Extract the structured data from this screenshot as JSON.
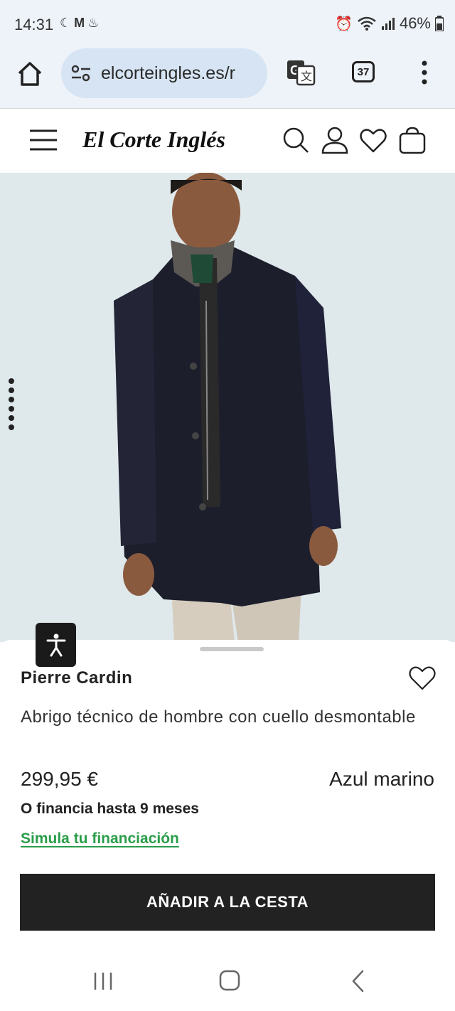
{
  "status_bar": {
    "time": "14:31",
    "left_icons": [
      "moon-icon",
      "gmail-icon",
      "notification-icon"
    ],
    "right_icons": [
      "alarm-icon",
      "wifi-icon",
      "signal-icon"
    ],
    "battery": "46%"
  },
  "browser": {
    "url": "elcorteingles.es/r",
    "tab_count": "37",
    "icons": [
      "home-icon",
      "site-settings-icon",
      "translate-icon",
      "tabs-icon",
      "more-vert-icon"
    ]
  },
  "site_header": {
    "logo_text": "El Corte Inglés",
    "icons": [
      "menu-icon",
      "search-icon",
      "account-icon",
      "wishlist-icon",
      "bag-icon"
    ]
  },
  "product": {
    "image_alt": "Model wearing navy technical coat",
    "brand": "Pierre Cardin",
    "title": "Abrigo técnico de hombre con cuello desmontable",
    "price": "299,95 €",
    "color": "Azul marino",
    "financing_text": "O financia hasta 9 meses",
    "financing_link": "Simula tu financiación",
    "add_to_cart": "AÑADIR A LA CESTA"
  },
  "colors": {
    "browser_bg": "#eef3fa",
    "url_pill": "#d6e4f3",
    "image_bg": "#dfe8ea",
    "link_green": "#2a9d4a",
    "cta_bg": "#222222"
  },
  "nav_bar": {
    "icons": [
      "recent-apps-icon",
      "home-button-icon",
      "back-icon"
    ]
  }
}
